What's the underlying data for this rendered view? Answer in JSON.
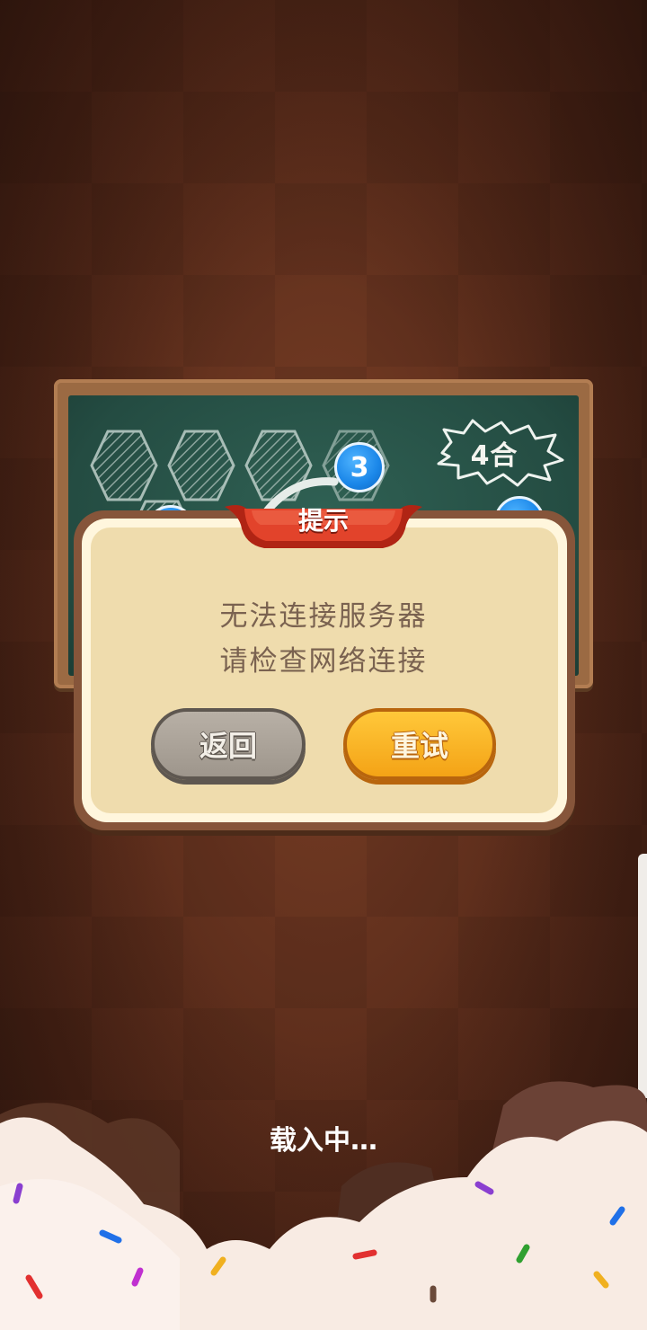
{
  "board": {
    "numbers": [
      "3"
    ],
    "badge_label": "4合"
  },
  "dialog": {
    "title": "提示",
    "message_line1": "无法连接服务器",
    "message_line2": "请检查网络连接",
    "back_label": "返回",
    "retry_label": "重试"
  },
  "loading_text": "载入中…",
  "colors": {
    "background": "#6a3521",
    "board": "#285248",
    "dialog_fill": "#efdcad",
    "ribbon": "#d8331e",
    "back_button": "#aaa299",
    "retry_button": "#fbb526",
    "number_bubble": "#1a86e8"
  }
}
